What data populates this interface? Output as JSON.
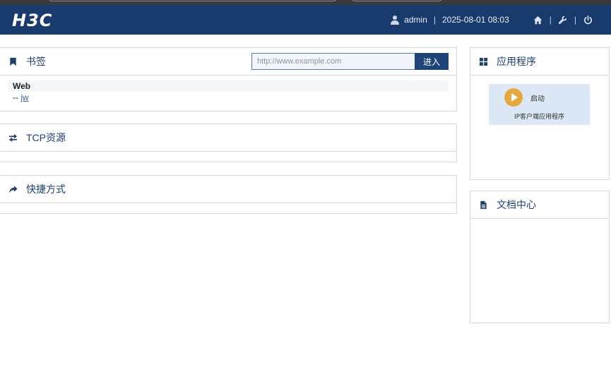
{
  "header": {
    "logo": "H3C",
    "username": "admin",
    "separator": "|",
    "datetime": "2025-08-01 08:03",
    "icons": [
      "home-icon",
      "wrench-icon",
      "power-icon"
    ],
    "bg_color": "#183a6c"
  },
  "bookmarks": {
    "title": "书签",
    "icon": "bookmark-icon",
    "url_placeholder": "http://www.example.com",
    "go_label": "进入",
    "groups": [
      {
        "name": "Web",
        "link_prefix": "--",
        "link_text": "jw"
      }
    ]
  },
  "tcp": {
    "title": "TCP资源",
    "icon": "exchange-icon"
  },
  "shortcuts": {
    "title": "快捷方式",
    "icon": "share-arrow-icon"
  },
  "apps": {
    "title": "应用程序",
    "icon": "grid-icon",
    "tile": {
      "launch_label": "启动",
      "name": "IP客户端应用程序",
      "icon": "play-icon"
    }
  },
  "docs": {
    "title": "文档中心",
    "icon": "document-icon"
  },
  "colors": {
    "accent": "#1e4478",
    "title_text": "#1d3f6e",
    "launch_icon": "#e3a93c",
    "tile_bg": "#dce8f6"
  }
}
